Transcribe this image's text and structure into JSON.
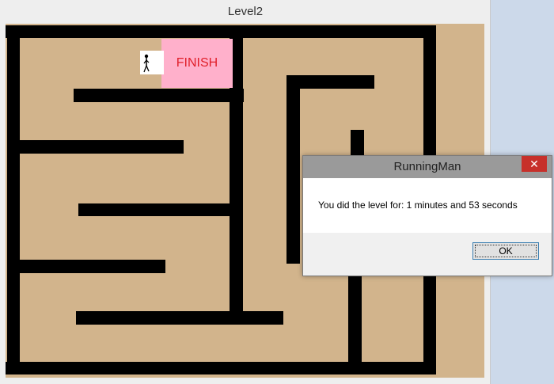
{
  "window": {
    "title": "Level2"
  },
  "maze": {
    "finish_label": "FINISH"
  },
  "dialog": {
    "title": "RunningMan",
    "close_glyph": "✕",
    "message": "You did the level for: 1 minutes  and 53 seconds",
    "ok_label": "OK"
  }
}
